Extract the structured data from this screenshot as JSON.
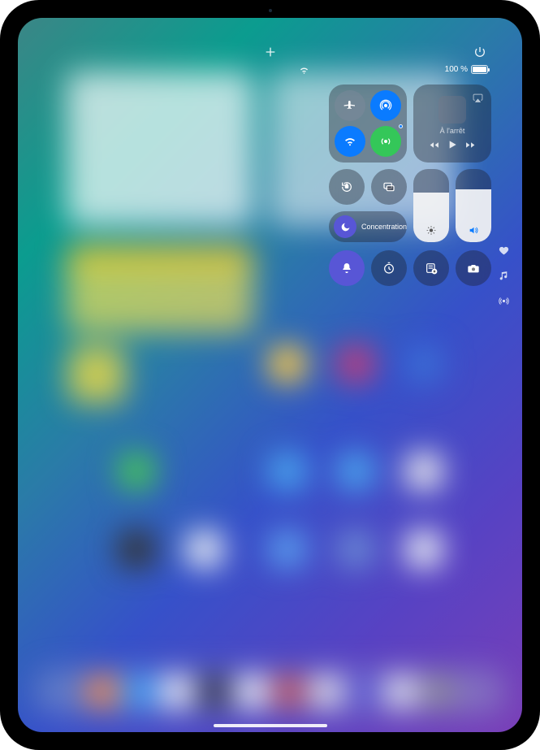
{
  "status_bar": {
    "battery_text": "100 %",
    "battery_level": 100
  },
  "top_icons": {
    "add": "plus-icon",
    "power": "power-icon",
    "wifi": "wifi-icon"
  },
  "control_center": {
    "connectivity": {
      "airplane": {
        "name": "airplane-icon",
        "active": false
      },
      "airdrop": {
        "name": "airdrop-icon",
        "active": true,
        "color": "#0a7bff"
      },
      "wifi": {
        "name": "wifi-icon",
        "active": true,
        "color": "#0a7bff"
      },
      "cellular": {
        "name": "cellular-icon",
        "active": true,
        "color": "#34c759",
        "bt_dot": true
      }
    },
    "media": {
      "status_text": "À l'arrêt",
      "airplay_icon": "airplay-icon",
      "rewind_icon": "rewind-icon",
      "play_icon": "play-icon",
      "forward_icon": "forward-icon"
    },
    "rotation_lock": {
      "name": "rotation-lock-icon"
    },
    "screen_mirroring": {
      "name": "screen-mirroring-icon"
    },
    "focus": {
      "label": "Concentration",
      "icon": "moon-icon"
    },
    "brightness": {
      "level": 68,
      "icon": "sun-icon"
    },
    "volume": {
      "level": 72,
      "icon": "speaker-icon"
    },
    "shortcuts": [
      {
        "name": "silent-mode-button",
        "icon": "bell-icon",
        "active": true,
        "color": "#5856d6"
      },
      {
        "name": "timer-button",
        "icon": "timer-icon",
        "active": false
      },
      {
        "name": "quick-note-button",
        "icon": "note-add-icon",
        "active": false
      },
      {
        "name": "camera-button",
        "icon": "camera-icon",
        "active": false
      }
    ]
  },
  "side_icons": [
    {
      "name": "favorite-icon",
      "icon": "heart-icon"
    },
    {
      "name": "music-note-icon",
      "icon": "music-icon"
    },
    {
      "name": "nearby-share-icon",
      "icon": "radio-waves-icon"
    }
  ]
}
